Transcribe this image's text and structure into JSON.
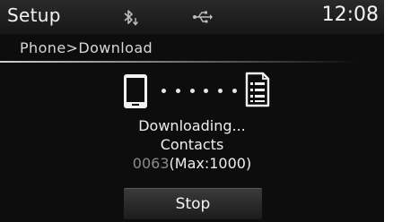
{
  "header": {
    "title": "Setup",
    "time": "12:08",
    "icons": [
      "bluetooth-download-icon",
      "usb-icon"
    ]
  },
  "breadcrumb": "Phone>Download",
  "transfer": {
    "icons": [
      "phone-icon",
      "contacts-list-icon"
    ],
    "status": "Downloading...",
    "item": "Contacts",
    "count": "0063",
    "max": "(Max:1000)"
  },
  "actions": {
    "stop_label": "Stop"
  },
  "colors": {
    "background": "#0d0d0d",
    "text": "#f2f2f2",
    "count": "#8a8a8a"
  }
}
